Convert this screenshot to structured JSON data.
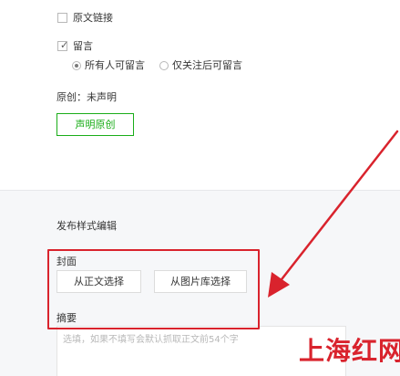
{
  "original_link": {
    "label": "原文链接",
    "checked": false
  },
  "comment": {
    "label": "留言",
    "checked": true,
    "options": [
      {
        "label": "所有人可留言",
        "selected": true
      },
      {
        "label": "仅关注后可留言",
        "selected": false
      }
    ]
  },
  "originality": {
    "status_text": "原创：未声明",
    "declare_button": "声明原创"
  },
  "style_edit": {
    "title": "发布样式编辑",
    "cover": {
      "label": "封面",
      "from_body_button": "从正文选择",
      "from_library_button": "从图片库选择"
    },
    "summary": {
      "label": "摘要",
      "placeholder": "选填，如果不填写会默认抓取正文前54个字"
    }
  },
  "watermark": "上海红网",
  "colors": {
    "accent_green": "#1aad19",
    "highlight_red": "#d9232d"
  }
}
